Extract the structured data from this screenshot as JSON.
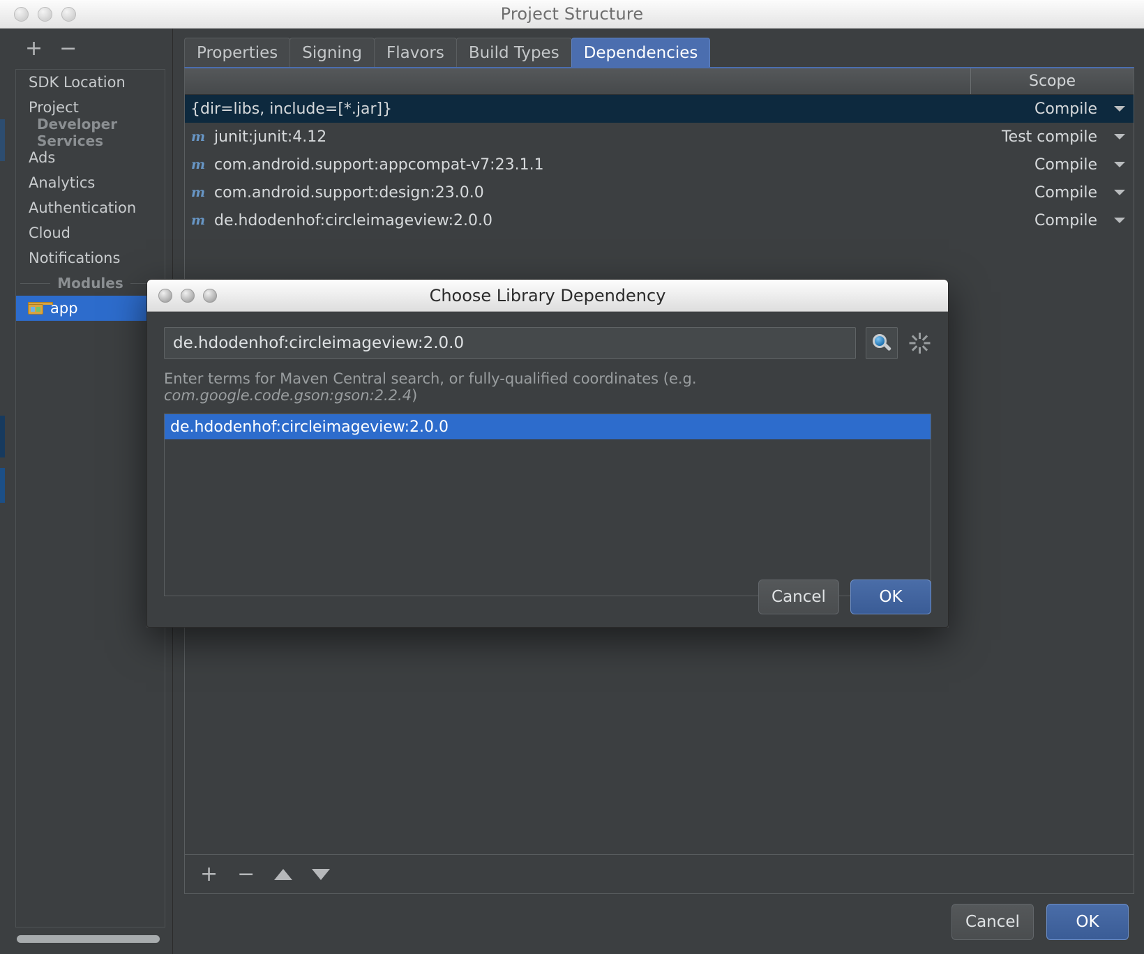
{
  "window": {
    "title": "Project Structure",
    "traffic_lights": [
      "close",
      "minimize",
      "zoom"
    ]
  },
  "sidebar": {
    "add_label": "+",
    "remove_label": "−",
    "items": [
      {
        "label": "SDK Location",
        "type": "item"
      },
      {
        "label": "Project",
        "type": "item"
      },
      {
        "label": "Developer Services",
        "type": "group"
      },
      {
        "label": "Ads",
        "type": "item"
      },
      {
        "label": "Analytics",
        "type": "item"
      },
      {
        "label": "Authentication",
        "type": "item"
      },
      {
        "label": "Cloud",
        "type": "item"
      },
      {
        "label": "Notifications",
        "type": "item"
      }
    ],
    "modules_separator": "Modules",
    "module": {
      "label": "app",
      "selected": true,
      "icon": "android-module-icon"
    }
  },
  "tabs": [
    {
      "label": "Properties",
      "active": false
    },
    {
      "label": "Signing",
      "active": false
    },
    {
      "label": "Flavors",
      "active": false
    },
    {
      "label": "Build Types",
      "active": false
    },
    {
      "label": "Dependencies",
      "active": true
    }
  ],
  "dependencies_table": {
    "columns": [
      "",
      "Scope"
    ],
    "rows": [
      {
        "name": "{dir=libs, include=[*.jar]}",
        "icon": "",
        "scope": "Compile",
        "selected": true
      },
      {
        "name": "junit:junit:4.12",
        "icon": "maven-icon",
        "scope": "Test compile",
        "selected": false
      },
      {
        "name": "com.android.support:appcompat-v7:23.1.1",
        "icon": "maven-icon",
        "scope": "Compile",
        "selected": false
      },
      {
        "name": "com.android.support:design:23.0.0",
        "icon": "maven-icon",
        "scope": "Compile",
        "selected": false
      },
      {
        "name": "de.hdodenhof:circleimageview:2.0.0",
        "icon": "maven-icon",
        "scope": "Compile",
        "selected": false
      }
    ],
    "toolbar": {
      "add": "+",
      "remove": "−",
      "move_up": "move-up",
      "move_down": "move-down"
    }
  },
  "main_footer": {
    "cancel_label": "Cancel",
    "ok_label": "OK"
  },
  "dialog": {
    "title": "Choose Library Dependency",
    "search": {
      "value": "de.hdodenhof:circleimageview:2.0.0",
      "placeholder": "",
      "search_icon": "search-icon",
      "spinner_icon": "loading-spinner-icon"
    },
    "hint_prefix": "Enter terms for Maven Central search, or fully-qualified coordinates (e.g. ",
    "hint_example": "com.google.code.gson:gson:2.2.4",
    "hint_suffix": ")",
    "results": [
      {
        "label": "de.hdodenhof:circleimageview:2.0.0",
        "selected": true
      }
    ],
    "cancel_label": "Cancel",
    "ok_label": "OK"
  },
  "colors": {
    "accent_blue": "#2d6ccc",
    "tab_active": "#4b6eaf",
    "row_selected": "#0d293e",
    "panel_bg": "#3c3f41",
    "maven_icon": "#6897c7"
  }
}
